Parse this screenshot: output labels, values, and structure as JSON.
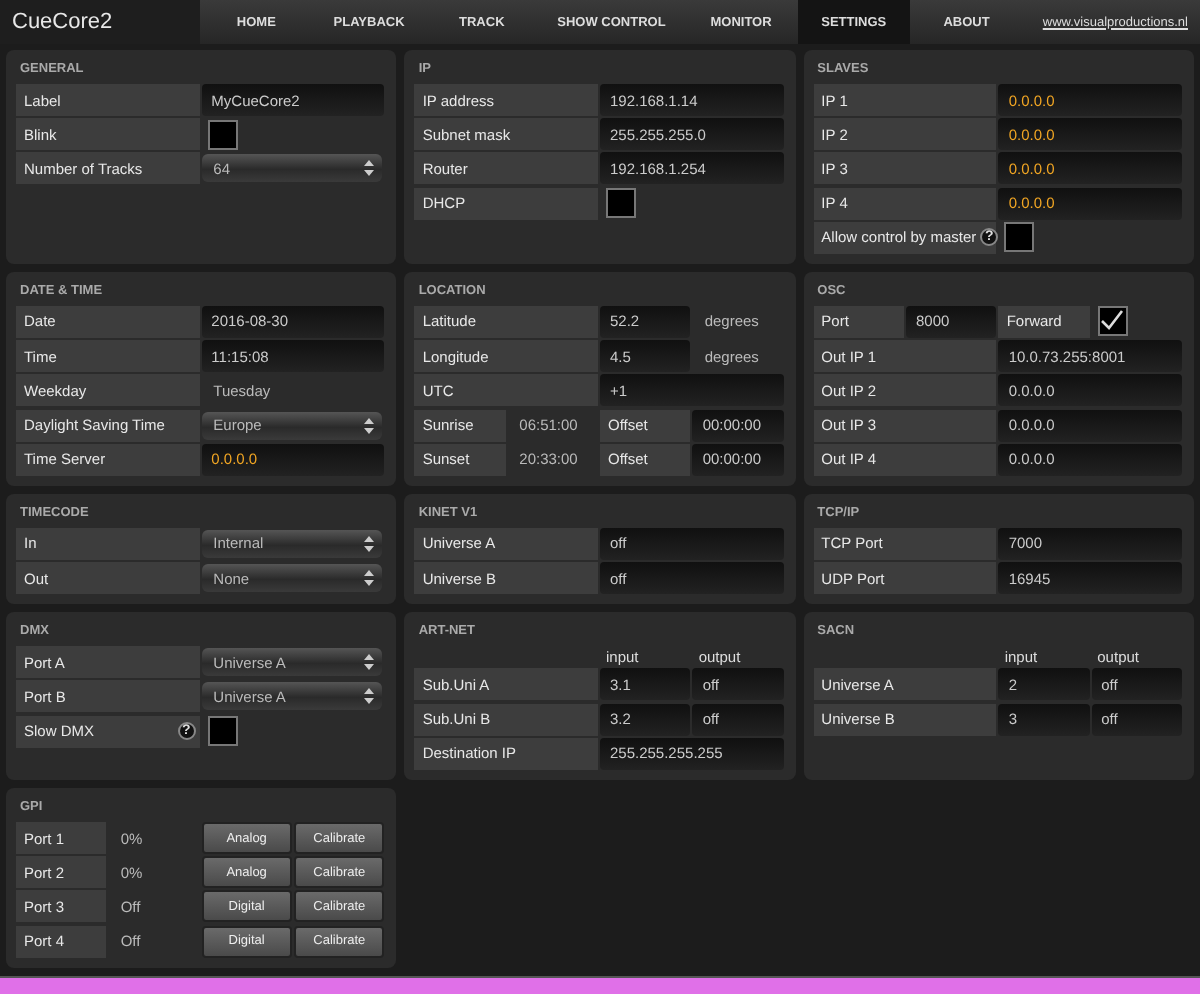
{
  "app": {
    "logo": "CueCore2",
    "link": "www.visualproductions.nl"
  },
  "tabs": [
    {
      "label": "HOME",
      "selected": false
    },
    {
      "label": "PLAYBACK",
      "selected": false
    },
    {
      "label": "TRACK",
      "selected": false
    },
    {
      "label": "SHOW CONTROL",
      "selected": false
    },
    {
      "label": "MONITOR",
      "selected": false
    },
    {
      "label": "SETTINGS",
      "selected": true
    },
    {
      "label": "ABOUT",
      "selected": false
    }
  ],
  "panels": [
    {
      "title": "GENERAL",
      "rows": [
        {
          "cells": [
            {
              "kind": "label",
              "text": "Label"
            },
            {
              "kind": "field",
              "text": "MyCueCore2"
            }
          ]
        },
        {
          "cells": [
            {
              "kind": "label",
              "text": "Blink"
            },
            {
              "kind": "checkbox",
              "checked": false
            }
          ]
        },
        {
          "cells": [
            {
              "kind": "label",
              "text": "Number of Tracks"
            },
            {
              "kind": "select",
              "text": "64"
            }
          ]
        }
      ]
    },
    {
      "title": "IP",
      "rows": [
        {
          "cells": [
            {
              "kind": "label",
              "text": "IP address"
            },
            {
              "kind": "field",
              "text": "192.168.1.14"
            }
          ]
        },
        {
          "cells": [
            {
              "kind": "label",
              "text": "Subnet mask"
            },
            {
              "kind": "field",
              "text": "255.255.255.0"
            }
          ]
        },
        {
          "cells": [
            {
              "kind": "label",
              "text": "Router"
            },
            {
              "kind": "field",
              "text": "192.168.1.254"
            }
          ]
        },
        {
          "cells": [
            {
              "kind": "label",
              "text": "DHCP"
            },
            {
              "kind": "checkbox",
              "checked": false
            }
          ]
        }
      ]
    },
    {
      "title": "SLAVES",
      "rows": [
        {
          "cells": [
            {
              "kind": "label",
              "text": "IP 1"
            },
            {
              "kind": "accent",
              "text": "0.0.0.0"
            }
          ]
        },
        {
          "cells": [
            {
              "kind": "label",
              "text": "IP 2"
            },
            {
              "kind": "accent",
              "text": "0.0.0.0"
            }
          ]
        },
        {
          "cells": [
            {
              "kind": "label",
              "text": "IP 3"
            },
            {
              "kind": "accent",
              "text": "0.0.0.0"
            }
          ]
        },
        {
          "cells": [
            {
              "kind": "label",
              "text": "IP 4"
            },
            {
              "kind": "accent",
              "text": "0.0.0.0"
            }
          ]
        },
        {
          "cells": [
            {
              "kind": "label",
              "text": "Allow control by master",
              "help": "?"
            },
            {
              "kind": "checkbox",
              "checked": false
            }
          ]
        }
      ]
    },
    {
      "title": "DATE & TIME",
      "rows": [
        {
          "cells": [
            {
              "kind": "label",
              "text": "Date"
            },
            {
              "kind": "field",
              "text": "2016-08-30"
            }
          ]
        },
        {
          "cells": [
            {
              "kind": "label",
              "text": "Time"
            },
            {
              "kind": "field",
              "text": "11:15:08"
            }
          ]
        },
        {
          "cells": [
            {
              "kind": "label",
              "text": "Weekday"
            },
            {
              "kind": "plain",
              "text": "Tuesday"
            }
          ]
        },
        {
          "cells": [
            {
              "kind": "label",
              "text": "Daylight Saving Time"
            },
            {
              "kind": "select",
              "text": "Europe"
            }
          ]
        },
        {
          "cells": [
            {
              "kind": "label",
              "text": "Time Server"
            },
            {
              "kind": "accent",
              "text": "0.0.0.0"
            }
          ]
        }
      ]
    },
    {
      "title": "LOCATION",
      "rows": [
        {
          "cells": [
            {
              "kind": "label",
              "text": "Latitude"
            },
            {
              "kind": "field",
              "text": "52.2"
            },
            {
              "kind": "plain",
              "text": "degrees"
            }
          ]
        },
        {
          "cells": [
            {
              "kind": "label",
              "text": "Longitude"
            },
            {
              "kind": "field",
              "text": "4.5"
            },
            {
              "kind": "plain",
              "text": "degrees"
            }
          ]
        },
        {
          "cells": [
            {
              "kind": "label",
              "text": "UTC"
            },
            {
              "kind": "field",
              "text": "+1"
            }
          ]
        },
        {
          "cells": [
            {
              "kind": "label",
              "text": "Sunrise"
            },
            {
              "kind": "plain",
              "text": "06:51:00"
            },
            {
              "kind": "label",
              "text": "Offset"
            },
            {
              "kind": "field",
              "text": "00:00:00"
            }
          ]
        },
        {
          "cells": [
            {
              "kind": "label",
              "text": "Sunset"
            },
            {
              "kind": "plain",
              "text": "20:33:00"
            },
            {
              "kind": "label",
              "text": "Offset"
            },
            {
              "kind": "field",
              "text": "00:00:00"
            }
          ]
        }
      ]
    },
    {
      "title": "OSC",
      "rows": [
        {
          "cells": [
            {
              "kind": "label",
              "text": "Port"
            },
            {
              "kind": "field",
              "text": "8000"
            },
            {
              "kind": "label",
              "text": "Forward"
            },
            {
              "kind": "checkbox",
              "checked": true
            }
          ]
        },
        {
          "cells": [
            {
              "kind": "label",
              "text": "Out IP 1"
            },
            {
              "kind": "field",
              "text": "10.0.73.255:8001"
            }
          ]
        },
        {
          "cells": [
            {
              "kind": "label",
              "text": "Out IP 2"
            },
            {
              "kind": "field",
              "text": "0.0.0.0"
            }
          ]
        },
        {
          "cells": [
            {
              "kind": "label",
              "text": "Out IP 3"
            },
            {
              "kind": "field",
              "text": "0.0.0.0"
            }
          ]
        },
        {
          "cells": [
            {
              "kind": "label",
              "text": "Out IP 4"
            },
            {
              "kind": "field",
              "text": "0.0.0.0"
            }
          ]
        }
      ]
    },
    {
      "title": "TIMECODE",
      "rows": [
        {
          "cells": [
            {
              "kind": "label",
              "text": "In"
            },
            {
              "kind": "select",
              "text": "Internal"
            }
          ]
        },
        {
          "cells": [
            {
              "kind": "label",
              "text": "Out"
            },
            {
              "kind": "select",
              "text": "None"
            }
          ]
        }
      ]
    },
    {
      "title": "KINET V1",
      "rows": [
        {
          "cells": [
            {
              "kind": "label",
              "text": "Universe A"
            },
            {
              "kind": "field",
              "text": "off"
            }
          ]
        },
        {
          "cells": [
            {
              "kind": "label",
              "text": "Universe B"
            },
            {
              "kind": "field",
              "text": "off"
            }
          ]
        }
      ]
    },
    {
      "title": "TCP/IP",
      "rows": [
        {
          "cells": [
            {
              "kind": "label",
              "text": "TCP Port"
            },
            {
              "kind": "field",
              "text": "7000"
            }
          ]
        },
        {
          "cells": [
            {
              "kind": "label",
              "text": "UDP Port"
            },
            {
              "kind": "field",
              "text": "16945"
            }
          ]
        }
      ]
    },
    {
      "title": "DMX",
      "rows": [
        {
          "cells": [
            {
              "kind": "label",
              "text": "Port A"
            },
            {
              "kind": "select",
              "text": "Universe A"
            }
          ]
        },
        {
          "cells": [
            {
              "kind": "label",
              "text": "Port B"
            },
            {
              "kind": "select",
              "text": "Universe A"
            }
          ]
        },
        {
          "cells": [
            {
              "kind": "label",
              "text": "Slow DMX",
              "help": "?"
            },
            {
              "kind": "checkbox",
              "checked": false
            }
          ]
        }
      ]
    },
    {
      "title": "ART-NET",
      "rows": [
        {
          "kind": "header",
          "cells": [
            {
              "kind": "blank"
            },
            {
              "kind": "plain",
              "text": "input"
            },
            {
              "kind": "plain",
              "text": "output"
            }
          ]
        },
        {
          "cells": [
            {
              "kind": "label",
              "text": "Sub.Uni A"
            },
            {
              "kind": "field",
              "text": "3.1"
            },
            {
              "kind": "field",
              "text": "off"
            }
          ]
        },
        {
          "cells": [
            {
              "kind": "label",
              "text": "Sub.Uni B"
            },
            {
              "kind": "field",
              "text": "3.2"
            },
            {
              "kind": "field",
              "text": "off"
            }
          ]
        },
        {
          "cells": [
            {
              "kind": "label",
              "text": "Destination IP"
            },
            {
              "kind": "field",
              "text": "255.255.255.255"
            }
          ]
        }
      ]
    },
    {
      "title": "SACN",
      "rows": [
        {
          "kind": "header",
          "cells": [
            {
              "kind": "blank"
            },
            {
              "kind": "plain",
              "text": "input"
            },
            {
              "kind": "plain",
              "text": "output"
            }
          ]
        },
        {
          "cells": [
            {
              "kind": "label",
              "text": "Universe A"
            },
            {
              "kind": "field",
              "text": "2"
            },
            {
              "kind": "field",
              "text": "off"
            }
          ]
        },
        {
          "cells": [
            {
              "kind": "label",
              "text": "Universe B"
            },
            {
              "kind": "field",
              "text": "3"
            },
            {
              "kind": "field",
              "text": "off"
            }
          ]
        }
      ]
    },
    {
      "title": "GPI",
      "rows": [
        {
          "cells": [
            {
              "kind": "label",
              "text": "Port 1"
            },
            {
              "kind": "plain",
              "text": "0%"
            },
            {
              "kind": "button",
              "text": "Analog"
            },
            {
              "kind": "button",
              "text": "Calibrate"
            }
          ]
        },
        {
          "cells": [
            {
              "kind": "label",
              "text": "Port 2"
            },
            {
              "kind": "plain",
              "text": "0%"
            },
            {
              "kind": "button",
              "text": "Analog"
            },
            {
              "kind": "button",
              "text": "Calibrate"
            }
          ]
        },
        {
          "cells": [
            {
              "kind": "label",
              "text": "Port 3"
            },
            {
              "kind": "plain",
              "text": "Off"
            },
            {
              "kind": "button",
              "text": "Digital"
            },
            {
              "kind": "button",
              "text": "Calibrate"
            }
          ]
        },
        {
          "cells": [
            {
              "kind": "label",
              "text": "Port 4"
            },
            {
              "kind": "plain",
              "text": "Off"
            },
            {
              "kind": "button",
              "text": "Digital"
            },
            {
              "kind": "button",
              "text": "Calibrate"
            }
          ]
        }
      ]
    }
  ]
}
